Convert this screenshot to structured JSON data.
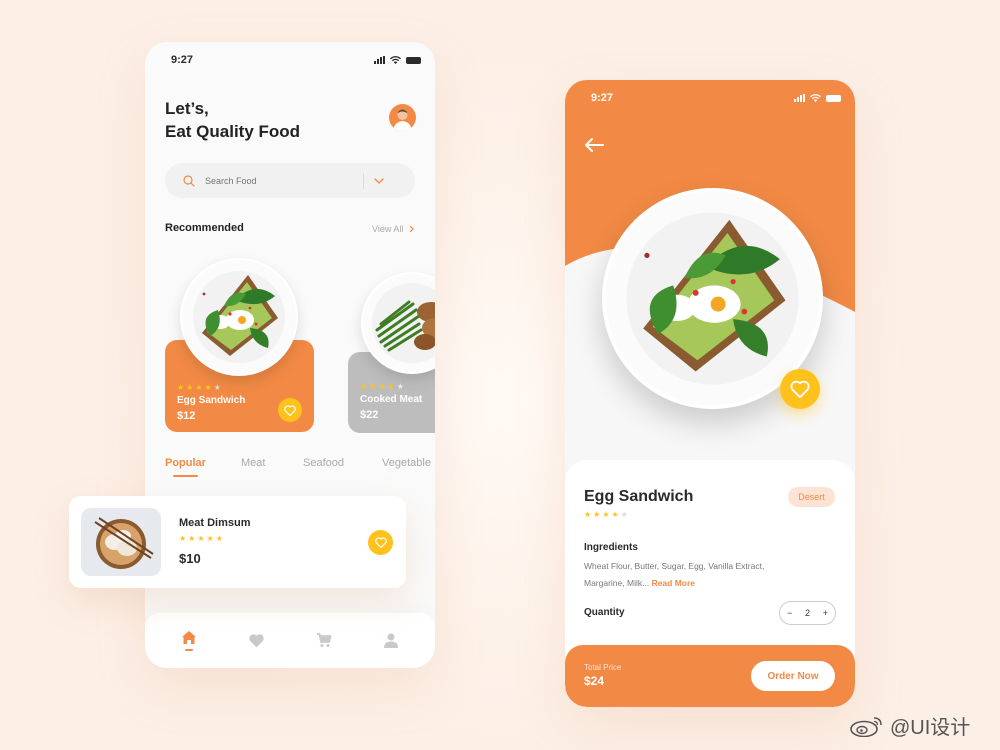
{
  "home": {
    "time": "9:27",
    "greeting_line1": "Let’s,",
    "greeting_line2": "Eat Quality Food",
    "search_placeholder": "Search Food",
    "recommended_title": "Recommended",
    "view_all": "View All",
    "recommended": [
      {
        "name": "Egg Sandwich",
        "price": "$12",
        "rating": 4
      },
      {
        "name": "Cooked Meat",
        "price": "$22",
        "rating": 4
      }
    ],
    "tabs": [
      "Popular",
      "Meat",
      "Seafood",
      "Vegetable"
    ],
    "active_tab": "Popular",
    "popular_item": {
      "name": "Meat Dimsum",
      "price": "$10",
      "rating": 5
    },
    "nav": [
      "home-icon",
      "heart-icon",
      "cart-icon",
      "profile-icon"
    ]
  },
  "detail": {
    "time": "9:27",
    "title": "Egg Sandwich",
    "category": "Desert",
    "rating": 4,
    "ingredients_title": "Ingredients",
    "ingredients_line1": "Wheat Flour, Butter, Sugar, Egg, Vanilla Extract,",
    "ingredients_line2": "Margarine, Milk...",
    "read_more": "Read More",
    "quantity_label": "Quantity",
    "quantity": "2",
    "minus": "−",
    "plus": "+",
    "total_label": "Total Price",
    "total": "$24",
    "order_button": "Order Now"
  },
  "watermark": "@UI设计",
  "colors": {
    "accent": "#f28a45",
    "star": "#ffc21c",
    "heart_button": "#ffc21c",
    "background": "#fcefe6"
  }
}
